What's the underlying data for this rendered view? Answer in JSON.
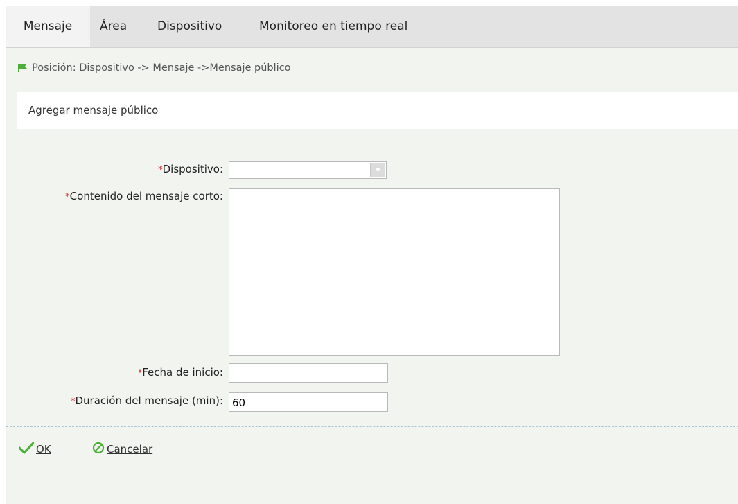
{
  "menu": {
    "tabs": [
      {
        "label": "Mensaje",
        "active": true
      },
      {
        "label": "Área",
        "active": false
      },
      {
        "label": "Dispositivo",
        "active": false
      },
      {
        "label": "Monitoreo en tiempo real",
        "active": false
      }
    ]
  },
  "breadcrumb": {
    "icon": "flag-icon",
    "text": "Posición: Dispositivo -> Mensaje ->Mensaje público"
  },
  "panel": {
    "title": "Agregar mensaje público"
  },
  "form": {
    "required_mark": "*",
    "device": {
      "label": "Dispositivo:",
      "value": ""
    },
    "content": {
      "label": "Contenido del mensaje corto:",
      "value": ""
    },
    "start_date": {
      "label": "Fecha de inicio:",
      "value": ""
    },
    "duration": {
      "label": "Duración del mensaje (min):",
      "value": "60"
    }
  },
  "actions": {
    "ok": {
      "label": "OK",
      "icon": "check-icon"
    },
    "cancel": {
      "label": "Cancelar",
      "icon": "cancel-icon"
    }
  },
  "colors": {
    "accent_green": "#4caf3a",
    "required_red": "#d32f2f",
    "menu_bg": "#e3e3e3",
    "content_bg": "#f2f5ef"
  }
}
